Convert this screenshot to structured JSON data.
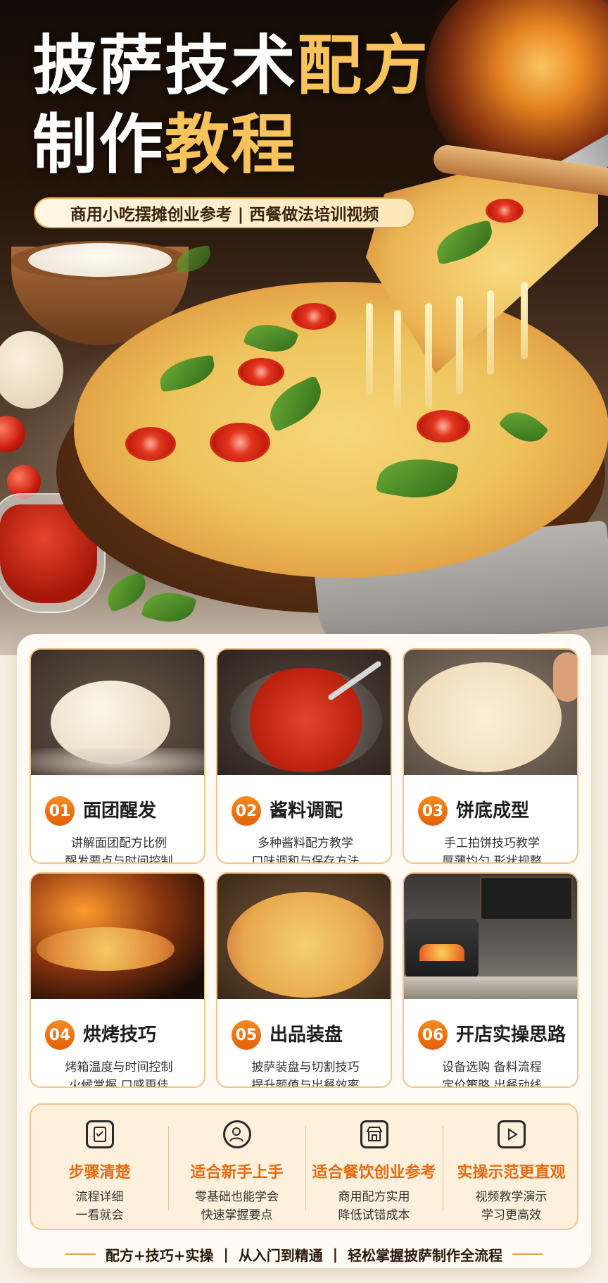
{
  "hero": {
    "title_line1_white": "披萨技术",
    "title_line1_gold": "配方",
    "title_line2_white": "制作",
    "title_line2_gold": "教程",
    "subtitle": "商用小吃摆摊创业参考 | 西餐做法培训视频"
  },
  "steps": [
    {
      "num": "01",
      "title": "面团醒发",
      "desc1": "讲解面团配方比例",
      "desc2": "醒发要点与时间控制"
    },
    {
      "num": "02",
      "title": "酱料调配",
      "desc1": "多种酱料配方教学",
      "desc2": "口味调和与保存方法"
    },
    {
      "num": "03",
      "title": "饼底成型",
      "desc1": "手工拍饼技巧教学",
      "desc2": "厚薄均匀 形状规整"
    },
    {
      "num": "04",
      "title": "烘烤技巧",
      "desc1": "烤箱温度与时间控制",
      "desc2": "火候掌握 口感更佳"
    },
    {
      "num": "05",
      "title": "出品装盘",
      "desc1": "披萨装盘与切割技巧",
      "desc2": "提升颜值与出餐效率"
    },
    {
      "num": "06",
      "title": "开店实操思路",
      "desc1": "设备选购 备料流程",
      "desc2": "定价策略 出餐动线"
    }
  ],
  "features": [
    {
      "icon": "clipboard-check-icon",
      "title": "步骤清楚",
      "desc1": "流程详细",
      "desc2": "一看就会"
    },
    {
      "icon": "user-check-icon",
      "title": "适合新手上手",
      "desc1": "零基础也能学会",
      "desc2": "快速掌握要点"
    },
    {
      "icon": "storefront-icon",
      "title": "适合餐饮创业参考",
      "desc1": "商用配方实用",
      "desc2": "降低试错成本"
    },
    {
      "icon": "play-video-icon",
      "title": "实操示范更直观",
      "desc1": "视频教学演示",
      "desc2": "学习更高效"
    }
  ],
  "footer": {
    "part1": "配方+技巧+实操",
    "sep": "|",
    "part2": "从入门到精通",
    "part3": "轻松掌握披萨制作全流程"
  },
  "colors": {
    "accent_orange": "#e86a10",
    "gold": "#f7c35a",
    "card_border": "#f0c48c"
  }
}
